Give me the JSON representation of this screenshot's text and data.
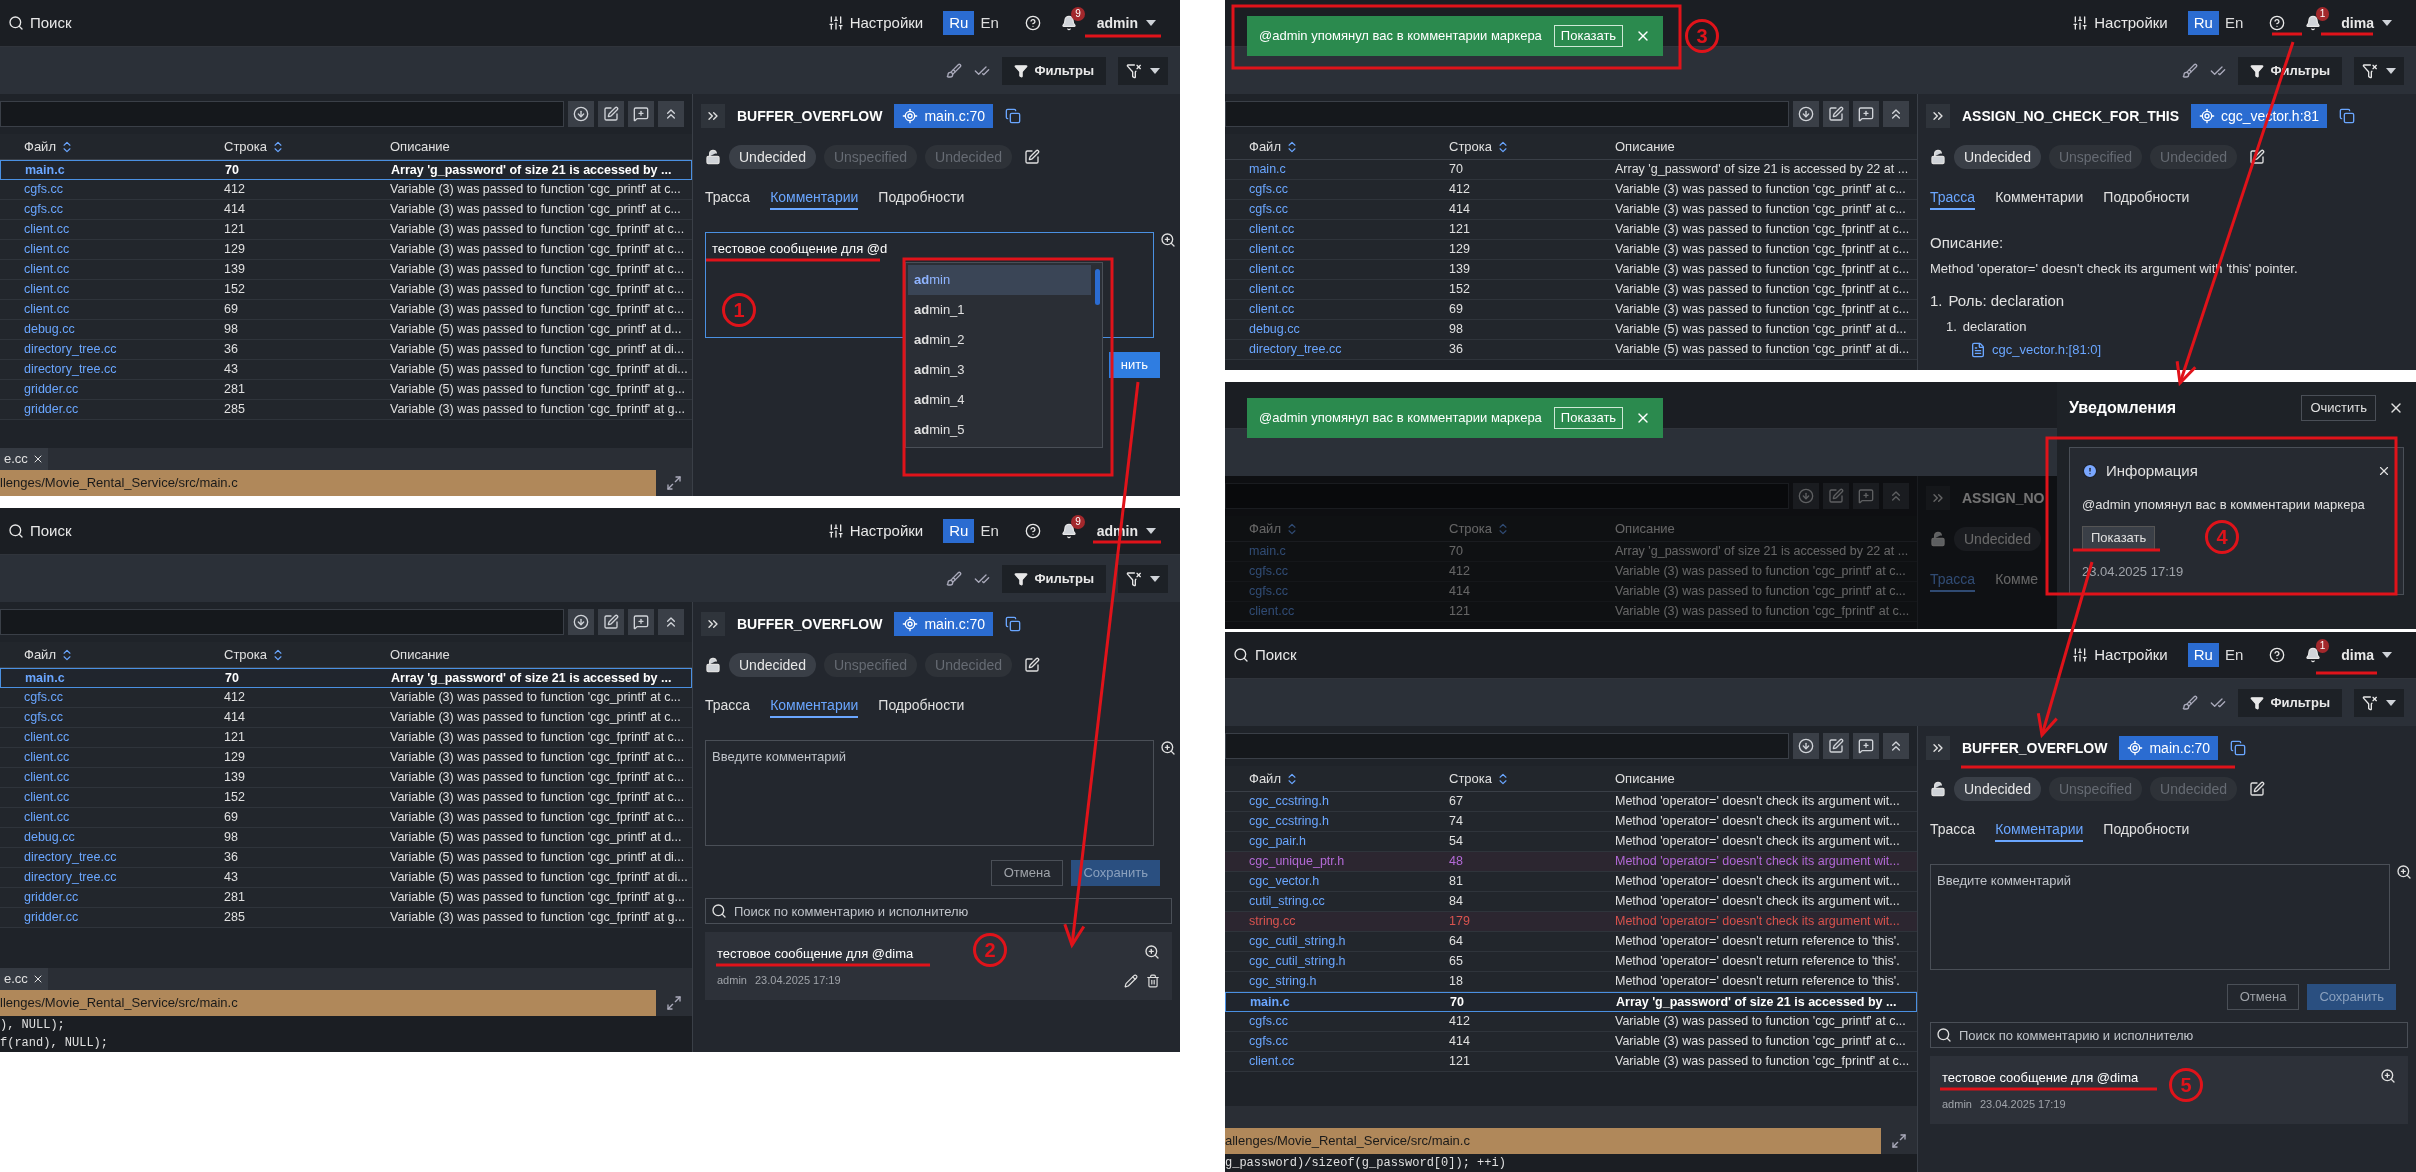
{
  "screens": [
    {
      "header": {
        "search": "Поиск",
        "settings": "Настройки",
        "languages": [
          {
            "label": "Ru",
            "selected": true
          },
          {
            "label": "En",
            "selected": false
          }
        ],
        "notification_count": "9",
        "user": "admin"
      },
      "toolbar": {
        "filters": "Фильтры"
      },
      "table": {
        "columns": [
          {
            "label": "Файл",
            "sortable": true
          },
          {
            "label": "Строка",
            "sortable": true
          },
          {
            "label": "Описание",
            "sortable": false
          }
        ],
        "rows": [
          {
            "file": "main.c",
            "line": "70",
            "description": "Array 'g_password' of size 21 is accessed by ...",
            "selected": true
          },
          {
            "file": "cgfs.cc",
            "line": "412",
            "description": "Variable (3) was passed to function 'cgc_printf' at c...",
            "selected": false
          },
          {
            "file": "cgfs.cc",
            "line": "414",
            "description": "Variable (3) was passed to function 'cgc_printf' at c...",
            "selected": false
          },
          {
            "file": "client.cc",
            "line": "121",
            "description": "Variable (3) was passed to function 'cgc_fprintf' at c...",
            "selected": false
          },
          {
            "file": "client.cc",
            "line": "129",
            "description": "Variable (3) was passed to function 'cgc_fprintf' at c...",
            "selected": false
          },
          {
            "file": "client.cc",
            "line": "139",
            "description": "Variable (3) was passed to function 'cgc_fprintf' at c...",
            "selected": false
          },
          {
            "file": "client.cc",
            "line": "152",
            "description": "Variable (3) was passed to function 'cgc_fprintf' at c...",
            "selected": false
          },
          {
            "file": "client.cc",
            "line": "69",
            "description": "Variable (3) was passed to function 'cgc_fprintf' at c...",
            "selected": false
          },
          {
            "file": "debug.cc",
            "line": "98",
            "description": "Variable (5) was passed to function 'cgc_printf' at d...",
            "selected": false
          },
          {
            "file": "directory_tree.cc",
            "line": "36",
            "description": "Variable (5) was passed to function 'cgc_printf' at di...",
            "selected": false
          },
          {
            "file": "directory_tree.cc",
            "line": "43",
            "description": "Variable (5) was passed to function 'cgc_fprintf' at di...",
            "selected": false
          },
          {
            "file": "gridder.cc",
            "line": "281",
            "description": "Variable (5) was passed to function 'cgc_fprintf' at g...",
            "selected": false
          },
          {
            "file": "gridder.cc",
            "line": "285",
            "description": "Variable (3) was passed to function 'cgc_fprintf' at g...",
            "selected": false
          }
        ]
      },
      "bottom": {
        "tab": "e.cc",
        "path": "llenges/Movie_Rental_Service/src/main.c"
      },
      "panel": {
        "checker": "BUFFER_OVERFLOW",
        "location": "main.c:70",
        "statuses": [
          {
            "label": "Undecided",
            "selected": true
          },
          {
            "label": "Unspecified",
            "selected": false
          },
          {
            "label": "Undecided",
            "selected": false
          }
        ],
        "tabs": [
          {
            "label": "Трасса",
            "selected": false
          },
          {
            "label": "Комментарии",
            "selected": true
          },
          {
            "label": "Подробности",
            "selected": false
          }
        ],
        "comment_box": {
          "value": "тестовое сообщение для @d",
          "focused": true
        },
        "mentions": [
          {
            "label": "**ad**min",
            "selected": true
          },
          {
            "label": "**ad**min_1",
            "selected": false
          },
          {
            "label": "**ad**min_2",
            "selected": false
          },
          {
            "label": "**ad**min_3",
            "selected": false
          },
          {
            "label": "**ad**min_4",
            "selected": false
          },
          {
            "label": "**ad**min_5",
            "selected": false
          }
        ],
        "buttons": [
          {
            "label": "нить",
            "kind": "primary",
            "disabled": false
          }
        ]
      }
    },
    {
      "header": {
        "search": "Поиск",
        "settings": "Настройки",
        "languages": [
          {
            "label": "Ru",
            "selected": true
          },
          {
            "label": "En",
            "selected": false
          }
        ],
        "notification_count": "9",
        "user": "admin"
      },
      "toolbar": {
        "filters": "Фильтры"
      },
      "table": {
        "columns": [
          {
            "label": "Файл",
            "sortable": true
          },
          {
            "label": "Строка",
            "sortable": true
          },
          {
            "label": "Описание",
            "sortable": false
          }
        ],
        "rows": [
          {
            "file": "main.c",
            "line": "70",
            "description": "Array 'g_password' of size 21 is accessed by ...",
            "selected": true
          },
          {
            "file": "cgfs.cc",
            "line": "412",
            "description": "Variable (3) was passed to function 'cgc_printf' at c...",
            "selected": false
          },
          {
            "file": "cgfs.cc",
            "line": "414",
            "description": "Variable (3) was passed to function 'cgc_printf' at c...",
            "selected": false
          },
          {
            "file": "client.cc",
            "line": "121",
            "description": "Variable (3) was passed to function 'cgc_fprintf' at c...",
            "selected": false
          },
          {
            "file": "client.cc",
            "line": "129",
            "description": "Variable (3) was passed to function 'cgc_fprintf' at c...",
            "selected": false
          },
          {
            "file": "client.cc",
            "line": "139",
            "description": "Variable (3) was passed to function 'cgc_fprintf' at c...",
            "selected": false
          },
          {
            "file": "client.cc",
            "line": "152",
            "description": "Variable (3) was passed to function 'cgc_fprintf' at c...",
            "selected": false
          },
          {
            "file": "client.cc",
            "line": "69",
            "description": "Variable (3) was passed to function 'cgc_fprintf' at c...",
            "selected": false
          },
          {
            "file": "debug.cc",
            "line": "98",
            "description": "Variable (5) was passed to function 'cgc_printf' at d...",
            "selected": false
          },
          {
            "file": "directory_tree.cc",
            "line": "36",
            "description": "Variable (5) was passed to function 'cgc_printf' at di...",
            "selected": false
          },
          {
            "file": "directory_tree.cc",
            "line": "43",
            "description": "Variable (5) was passed to function 'cgc_fprintf' at di...",
            "selected": false
          },
          {
            "file": "gridder.cc",
            "line": "281",
            "description": "Variable (5) was passed to function 'cgc_fprintf' at g...",
            "selected": false
          },
          {
            "file": "gridder.cc",
            "line": "285",
            "description": "Variable (3) was passed to function 'cgc_fprintf' at g...",
            "selected": false
          }
        ]
      },
      "bottom": {
        "tab": "e.cc",
        "path": "llenges/Movie_Rental_Service/src/main.c",
        "code": [
          "), NULL);",
          "f(rand), NULL);"
        ]
      },
      "panel": {
        "checker": "BUFFER_OVERFLOW",
        "location": "main.c:70",
        "statuses": [
          {
            "label": "Undecided",
            "selected": true
          },
          {
            "label": "Unspecified",
            "selected": false
          },
          {
            "label": "Undecided",
            "selected": false
          }
        ],
        "tabs": [
          {
            "label": "Трасса",
            "selected": false
          },
          {
            "label": "Комментарии",
            "selected": true
          },
          {
            "label": "Подробности",
            "selected": false
          }
        ],
        "comment_box": {
          "placeholder": "Введите комментарий",
          "focused": false
        },
        "buttons": [
          {
            "label": "Отмена",
            "kind": "secondary",
            "disabled": false
          },
          {
            "label": "Сохранить",
            "kind": "primary",
            "disabled": true
          }
        ],
        "comment_search": {
          "placeholder": "Поиск по комментарию и исполнителю"
        },
        "comments": [
          {
            "text": "тестовое сообщение для @dima",
            "author": "admin",
            "time": "23.04.2025 17:19",
            "editable": true
          }
        ]
      }
    },
    {
      "header": {
        "settings": "Настройки",
        "languages": [
          {
            "label": "Ru",
            "selected": true
          },
          {
            "label": "En",
            "selected": false
          }
        ],
        "notification_count": "1",
        "user": "dima"
      },
      "toolbar": {
        "filters": "Фильтры"
      },
      "toast": {
        "text": "@admin упомянул вас в комментарии маркера",
        "action": "Показать"
      },
      "table": {
        "columns": [
          {
            "label": "Файл",
            "sortable": true
          },
          {
            "label": "Строка",
            "sortable": true
          },
          {
            "label": "Описание",
            "sortable": false
          }
        ],
        "rows": [
          {
            "file": "main.c",
            "line": "70",
            "description": "Array 'g_password' of size 21 is accessed by 22 at ...",
            "selected": false
          },
          {
            "file": "cgfs.cc",
            "line": "412",
            "description": "Variable (3) was passed to function 'cgc_printf' at c...",
            "selected": false
          },
          {
            "file": "cgfs.cc",
            "line": "414",
            "description": "Variable (3) was passed to function 'cgc_printf' at c...",
            "selected": false
          },
          {
            "file": "client.cc",
            "line": "121",
            "description": "Variable (3) was passed to function 'cgc_fprintf' at c...",
            "selected": false
          },
          {
            "file": "client.cc",
            "line": "129",
            "description": "Variable (3) was passed to function 'cgc_fprintf' at c...",
            "selected": false
          },
          {
            "file": "client.cc",
            "line": "139",
            "description": "Variable (3) was passed to function 'cgc_fprintf' at c...",
            "selected": false
          },
          {
            "file": "client.cc",
            "line": "152",
            "description": "Variable (3) was passed to function 'cgc_fprintf' at c...",
            "selected": false
          },
          {
            "file": "client.cc",
            "line": "69",
            "description": "Variable (3) was passed to function 'cgc_fprintf' at c...",
            "selected": false
          },
          {
            "file": "debug.cc",
            "line": "98",
            "description": "Variable (5) was passed to function 'cgc_printf' at d...",
            "selected": false
          },
          {
            "file": "directory_tree.cc",
            "line": "36",
            "description": "Variable (5) was passed to function 'cgc_printf' at di...",
            "selected": false
          }
        ]
      },
      "panel": {
        "checker": "ASSIGN_NO_CHECK_FOR_THIS",
        "location": "cgc_vector.h:81",
        "statuses": [
          {
            "label": "Undecided",
            "selected": true
          },
          {
            "label": "Unspecified",
            "selected": false
          },
          {
            "label": "Undecided",
            "selected": false
          }
        ],
        "tabs": [
          {
            "label": "Трасса",
            "selected": true
          },
          {
            "label": "Комментарии",
            "selected": false
          },
          {
            "label": "Подробности",
            "selected": false
          }
        ],
        "trace": {
          "heading": "Описание:",
          "text": "Method 'operator=' doesn't check its argument with 'this' pointer.",
          "steps": [
            {
              "marker": "1.",
              "label": "Роль: declaration",
              "children": [
                {
                  "marker": "1.",
                  "label": "declaration",
                  "link": "cgc_vector.h:[81:0]"
                }
              ]
            }
          ]
        }
      }
    },
    {
      "dimmed": true,
      "toast": {
        "text": "@admin упомянул вас в комментарии маркера",
        "action": "Показать"
      },
      "table": {
        "columns": [
          {
            "label": "Файл",
            "sortable": true
          },
          {
            "label": "Строка",
            "sortable": true
          },
          {
            "label": "Описание",
            "sortable": false
          }
        ],
        "rows": [
          {
            "file": "main.c",
            "line": "70",
            "description": "Array 'g_password' of size 21 is accessed by 22 at ...",
            "selected": false
          },
          {
            "file": "cgfs.cc",
            "line": "412",
            "description": "Variable (3) was passed to function 'cgc_printf' at c...",
            "selected": false
          },
          {
            "file": "cgfs.cc",
            "line": "414",
            "description": "Variable (3) was passed to function 'cgc_printf' at c...",
            "selected": false
          },
          {
            "file": "client.cc",
            "line": "121",
            "description": "Variable (3) was passed to function 'cgc_fprintf' at c...",
            "selected": false
          }
        ]
      },
      "panel": {
        "checker": "ASSIGN_NO",
        "statuses": [
          {
            "label": "Undecided",
            "selected": true
          }
        ],
        "tabs": [
          {
            "label": "Трасса",
            "selected": true
          },
          {
            "label": "Комме",
            "selected": false
          }
        ]
      },
      "notifications": {
        "title": "Уведомления",
        "clear": "Очистить",
        "items": [
          {
            "kind": "info",
            "title": "Информация",
            "text": "@admin упомянул вас в комментарии маркера",
            "action": "Показать",
            "time": "23.04.2025 17:19"
          }
        ]
      }
    },
    {
      "header": {
        "search": "Поиск",
        "settings": "Настройки",
        "languages": [
          {
            "label": "Ru",
            "selected": true
          },
          {
            "label": "En",
            "selected": false
          }
        ],
        "notification_count": "1",
        "user": "dima"
      },
      "toolbar": {
        "filters": "Фильтры"
      },
      "table": {
        "columns": [
          {
            "label": "Файл",
            "sortable": true
          },
          {
            "label": "Строка",
            "sortable": true
          },
          {
            "label": "Описание",
            "sortable": false
          }
        ],
        "rows": [
          {
            "file": "cgc_ccstring.h",
            "line": "67",
            "description": "Method 'operator=' doesn't check its argument wit...",
            "selected": false
          },
          {
            "file": "cgc_ccstring.h",
            "line": "74",
            "description": "Method 'operator=' doesn't check its argument wit...",
            "selected": false
          },
          {
            "file": "cgc_pair.h",
            "line": "54",
            "description": "Method 'operator=' doesn't check its argument wit...",
            "selected": false
          },
          {
            "file": "cgc_unique_ptr.h",
            "line": "48",
            "description": "Method 'operator=' doesn't check its argument wit...",
            "selected": false,
            "color": "#b36ad6"
          },
          {
            "file": "cgc_vector.h",
            "line": "81",
            "description": "Method 'operator=' doesn't check its argument wit...",
            "selected": false
          },
          {
            "file": "cutil_string.cc",
            "line": "84",
            "description": "Method 'operator=' doesn't check its argument wit...",
            "selected": false
          },
          {
            "file": "string.cc",
            "line": "179",
            "description": "Method 'operator=' doesn't check its argument wit...",
            "selected": false,
            "color": "#d9534f"
          },
          {
            "file": "cgc_cutil_string.h",
            "line": "64",
            "description": "Method 'operator=' doesn't return reference to 'this'.",
            "selected": false
          },
          {
            "file": "cgc_cutil_string.h",
            "line": "65",
            "description": "Method 'operator=' doesn't return reference to 'this'.",
            "selected": false
          },
          {
            "file": "cgc_string.h",
            "line": "18",
            "description": "Method 'operator=' doesn't return reference to 'this'.",
            "selected": false
          },
          {
            "file": "main.c",
            "line": "70",
            "description": "Array 'g_password' of size 21 is accessed by ...",
            "selected": true
          },
          {
            "file": "cgfs.cc",
            "line": "412",
            "description": "Variable (3) was passed to function 'cgc_printf' at c...",
            "selected": false
          },
          {
            "file": "cgfs.cc",
            "line": "414",
            "description": "Variable (3) was passed to function 'cgc_printf' at c...",
            "selected": false
          },
          {
            "file": "client.cc",
            "line": "121",
            "description": "Variable (3) was passed to function 'cgc_fprintf' at c...",
            "selected": false
          }
        ]
      },
      "bottom": {
        "path": "allenges/Movie_Rental_Service/src/main.c",
        "code": [
          "g_password)/sizeof(g_password[0]); ++i)"
        ]
      },
      "panel": {
        "checker": "BUFFER_OVERFLOW",
        "location": "main.c:70",
        "statuses": [
          {
            "label": "Undecided",
            "selected": true
          },
          {
            "label": "Unspecified",
            "selected": false
          },
          {
            "label": "Undecided",
            "selected": false
          }
        ],
        "tabs": [
          {
            "label": "Трасса",
            "selected": false
          },
          {
            "label": "Комментарии",
            "selected": true
          },
          {
            "label": "Подробности",
            "selected": false
          }
        ],
        "comment_box": {
          "placeholder": "Введите комментарий",
          "focused": false
        },
        "buttons": [
          {
            "label": "Отмена",
            "kind": "secondary",
            "disabled": false
          },
          {
            "label": "Сохранить",
            "kind": "primary",
            "disabled": true
          }
        ],
        "comment_search": {
          "placeholder": "Поиск по комментарию и исполнителю"
        },
        "comments": [
          {
            "text": "тестовое сообщение для @dima",
            "author": "admin",
            "time": "23.04.2025 17:19",
            "editable": false
          }
        ]
      }
    }
  ],
  "annotations": [
    {
      "label": "1"
    },
    {
      "label": "2"
    },
    {
      "label": "3"
    },
    {
      "label": "4"
    },
    {
      "label": "5"
    }
  ]
}
